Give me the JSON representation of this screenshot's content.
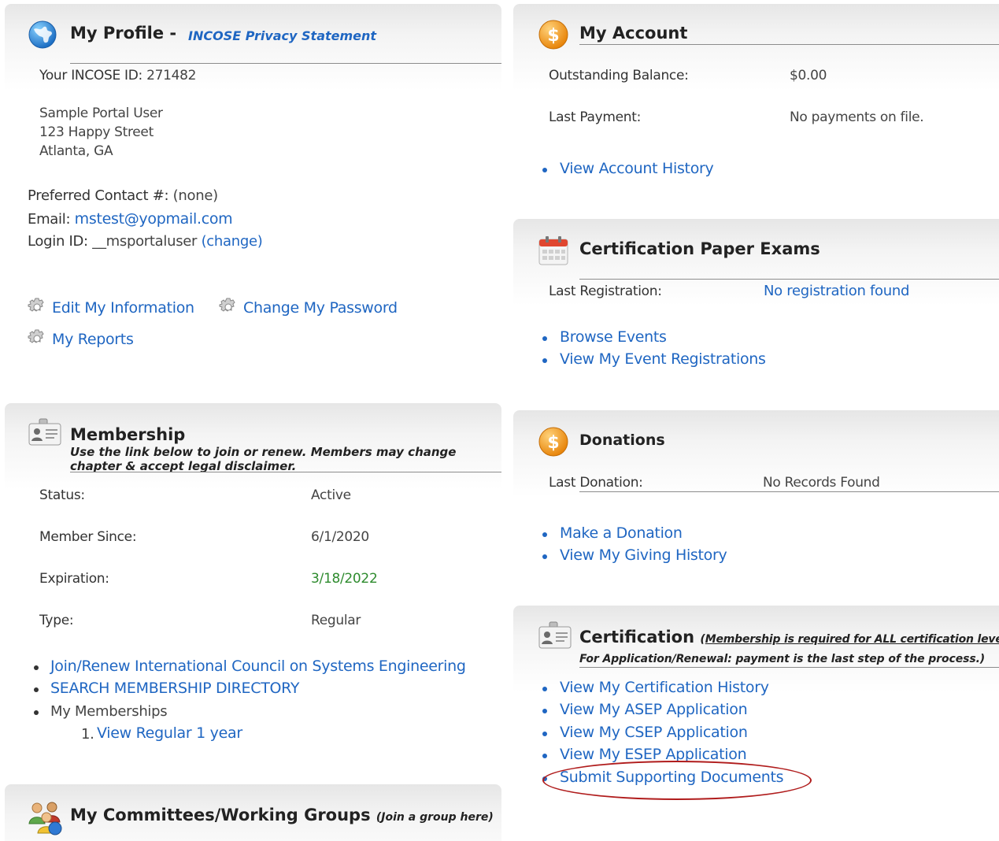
{
  "profile": {
    "title": "My Profile",
    "dash": "-",
    "privacy_link": "INCOSE Privacy Statement",
    "id_label": "Your INCOSE ID:",
    "id_value": "271482",
    "address": [
      "Sample Portal User",
      "123 Happy Street",
      "Atlanta, GA"
    ],
    "contact_label": "Preferred Contact #:",
    "contact_value": "(none)",
    "email_label": "Email:",
    "email_value": "mstest@yopmail.com",
    "login_label": "Login ID:",
    "login_value": "__msportaluser",
    "change_link": "(change)",
    "edit_info": "Edit My Information",
    "change_password": "Change My Password",
    "my_reports": "My Reports"
  },
  "membership": {
    "title": "Membership",
    "note_line1": "Use the link below to join or renew.  Members may change",
    "note_line2": "chapter & accept legal disclaimer.",
    "status_label": "Status:",
    "status_value": "Active",
    "since_label": "Member Since:",
    "since_value": "6/1/2020",
    "expiration_label": "Expiration:",
    "expiration_value": "3/18/2022",
    "expiration_color": "#2e8b2e",
    "type_label": "Type:",
    "type_value": "Regular",
    "join_link": "Join/Renew International Council on Systems Engineering",
    "search_link": "SEARCH MEMBERSHIP DIRECTORY",
    "my_memberships": "My Memberships",
    "list_num": "1.",
    "view_regular": "View Regular 1 year"
  },
  "committees": {
    "title": "My Committees/Working Groups",
    "join_note": "(Join a group here)"
  },
  "account": {
    "title": "My Account",
    "balance_label": "Outstanding Balance:",
    "balance_value": "$0.00",
    "payment_label": "Last Payment:",
    "payment_value": "No payments on file.",
    "history_link": "View Account History"
  },
  "exams": {
    "title": "Certification Paper Exams",
    "reg_label": "Last Registration:",
    "reg_value": "No registration found",
    "browse_link": "Browse Events",
    "registrations_link": "View My Event Registrations"
  },
  "donations": {
    "title": "Donations",
    "last_label": "Last Donation:",
    "last_value": "No Records Found",
    "make_link": "Make a Donation",
    "history_link": "View My Giving History"
  },
  "certification": {
    "title": "Certification",
    "note_open": "(",
    "note_underlined": "Membership is required for ALL certification levels.",
    "note_line2": "For Application/Renewal: payment is the last step of the process.)",
    "links": [
      "View My Certification History",
      "View My ASEP Application",
      "View My CSEP Application",
      "View My ESEP Application",
      "Submit Supporting Documents"
    ],
    "highlight_color": "#b01c1c"
  },
  "icons": {
    "profile": "globe-icon",
    "account": "dollar-coin-icon",
    "exams": "calendar-icon",
    "donations": "dollar-coin-icon",
    "membership": "id-card-icon",
    "certification": "id-card-icon",
    "committees": "people-group-icon",
    "actions": "gear-icon"
  }
}
